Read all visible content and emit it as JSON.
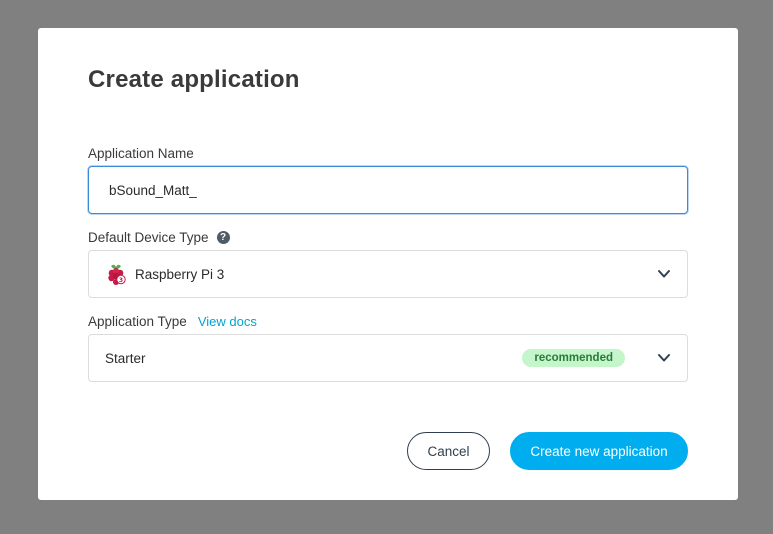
{
  "dialog": {
    "title": "Create application",
    "name_field": {
      "label": "Application Name",
      "value": "bSound_Matt_"
    },
    "device_type": {
      "label": "Default Device Type",
      "help_icon": "question-circle-icon",
      "value": "Raspberry Pi 3",
      "logo_icon": "raspberry-pi-icon"
    },
    "app_type": {
      "label": "Application Type",
      "docs_link": "View docs",
      "value": "Starter",
      "badge": "recommended"
    },
    "buttons": {
      "cancel": "Cancel",
      "create": "Create new application"
    }
  },
  "colors": {
    "overlay": "#808080",
    "primary": "#00aeef",
    "link": "#00a3d4",
    "badge_bg": "#c4f5cb",
    "badge_text": "#2b7a3b",
    "focus_border": "#3d8ad6"
  }
}
